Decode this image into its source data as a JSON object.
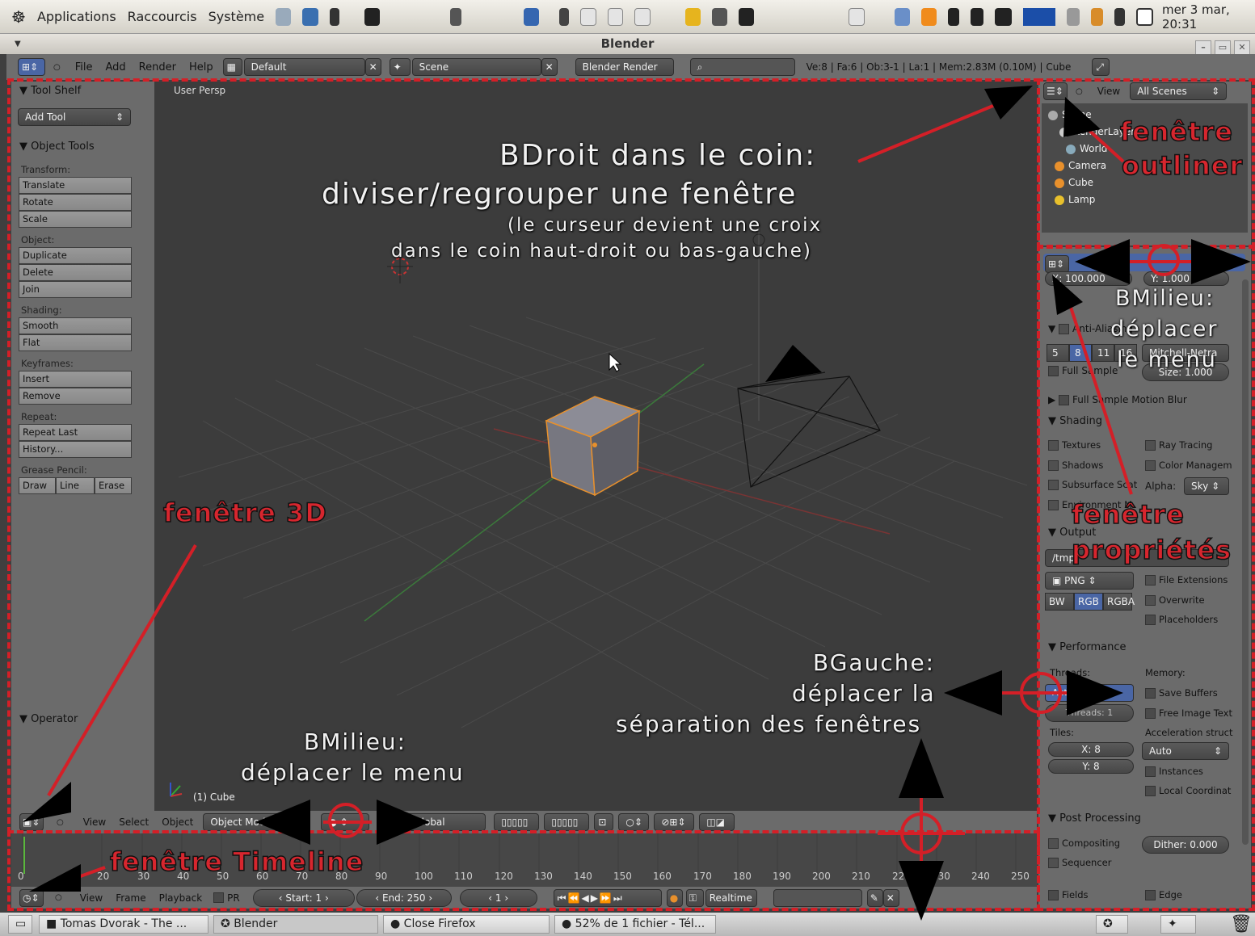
{
  "gnome_panel": {
    "menus": [
      "Applications",
      "Raccourcis",
      "Système"
    ],
    "clock": "mer  3 mar, 20:31"
  },
  "window": {
    "title": "Blender"
  },
  "info_header": {
    "menus": [
      "File",
      "Add",
      "Render",
      "Help"
    ],
    "layout": "Default",
    "scene": "Scene",
    "engine": "Blender Render",
    "stats": "Ve:8 | Fa:6 | Ob:3-1 | La:1 | Mem:2.83M (0.10M) | Cube"
  },
  "tool_shelf": {
    "title": "Tool Shelf",
    "add_tool": "Add Tool",
    "object_tools": "Object Tools",
    "groups": [
      {
        "label": "Transform:",
        "buttons": [
          "Translate",
          "Rotate",
          "Scale"
        ]
      },
      {
        "label": "Object:",
        "buttons": [
          "Duplicate",
          "Delete",
          "Join"
        ]
      },
      {
        "label": "Shading:",
        "buttons": [
          "Smooth",
          "Flat"
        ]
      },
      {
        "label": "Keyframes:",
        "buttons": [
          "Insert",
          "Remove"
        ]
      },
      {
        "label": "Repeat:",
        "buttons": [
          "Repeat Last",
          "History..."
        ]
      }
    ],
    "grease_pencil": "Grease Pencil:",
    "gp_buttons": [
      "Draw",
      "Line",
      "Erase"
    ],
    "operator": "Operator"
  },
  "viewport": {
    "label": "User Persp",
    "object": "(1) Cube"
  },
  "header_3d": {
    "menus": [
      "View",
      "Select",
      "Object"
    ],
    "mode": "Object Mode",
    "orientation": "Global"
  },
  "timeline": {
    "ticks": [
      "0",
      "20",
      "30",
      "40",
      "50",
      "60",
      "70",
      "80",
      "90",
      "100",
      "110",
      "120",
      "130",
      "140",
      "150",
      "160",
      "170",
      "180",
      "190",
      "200",
      "210",
      "220",
      "230",
      "240",
      "250"
    ],
    "menus": [
      "View",
      "Frame",
      "Playback"
    ],
    "pr": "PR",
    "start": "Start: 1",
    "end": "End: 250",
    "current": "1",
    "realtime": "Realtime"
  },
  "outliner": {
    "view": "View",
    "scenes": "All Scenes",
    "items": [
      "Scene",
      "RenderLayers",
      "World",
      "Camera",
      "Cube",
      "Lamp"
    ]
  },
  "properties": {
    "res_x": "X: 100.000",
    "res_y": "Y: 1.000",
    "anti_alias": "Anti-Aliasing",
    "aa_values": [
      "5",
      "8",
      "11",
      "16"
    ],
    "filter": "Mitchell-Netra",
    "full_sample": "Full Sample",
    "size": "Size: 1.000",
    "motion_blur": "Full Sample Motion Blur",
    "shading": "Shading",
    "shading_left": [
      "Textures",
      "Shadows",
      "Subsurface Scat",
      "Environment M"
    ],
    "shading_right": [
      "Ray Tracing",
      "Color Managem"
    ],
    "alpha": "Alpha:",
    "alpha_val": "Sky",
    "output": "Output",
    "path": "/tmp/",
    "format": "PNG",
    "color_modes": [
      "BW",
      "RGB",
      "RGBA"
    ],
    "output_right": [
      "File Extensions",
      "Overwrite",
      "Placeholders"
    ],
    "performance": "Performance",
    "threads": "Threads:",
    "memory": "Memory:",
    "threads_mode": "Auto-detect",
    "threads_val": "Threads: 1",
    "mem_opts": [
      "Save Buffers",
      "Free Image Text"
    ],
    "tiles": "Tiles:",
    "accel": "Acceleration struct",
    "tx": "X: 8",
    "ty": "Y: 8",
    "accel_val": "Auto",
    "accel_opts": [
      "Instances",
      "Local Coordinat"
    ],
    "post": "Post Processing",
    "compositing": "Compositing",
    "sequencer": "Sequencer",
    "dither": "Dither: 0.000",
    "fields": "Fields",
    "edge": "Edge"
  },
  "annotations": {
    "split_title1": "BDroit dans le coin:",
    "split_title2": "diviser/regrouper une fenêtre",
    "split_sub1": "(le curseur devient une croix",
    "split_sub2": "dans le coin haut-droit ou bas-gauche)",
    "outliner1": "fenêtre",
    "outliner2": "outliner",
    "bmilieu_r1": "BMilieu:",
    "bmilieu_r2": "déplacer",
    "bmilieu_r3": "le menu",
    "props1": "fenêtre",
    "props2": "propriétés",
    "win3d": "fenêtre 3D",
    "bgauche1": "BGauche:",
    "bgauche2": "déplacer la",
    "bgauche3": "séparation des fenêtres",
    "bmilieu_b1": "BMilieu:",
    "bmilieu_b2": "déplacer le menu",
    "timeline": "fenêtre Timeline"
  },
  "taskbar": {
    "tasks": [
      "Tomas Dvorak - The ...",
      "Blender",
      "Close Firefox",
      "52% de 1 fichier - Tél..."
    ]
  },
  "colors": {
    "annotation_red": "#d41f27",
    "selected_orange": "#e8902c"
  }
}
